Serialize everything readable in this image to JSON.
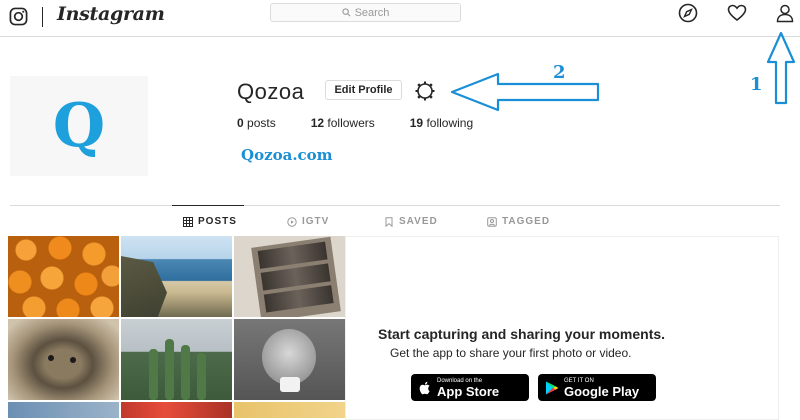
{
  "topbar": {
    "brand": "Instagram",
    "search_placeholder": "Search",
    "icons": [
      "instagram-glyph-icon",
      "search-icon",
      "compass-icon",
      "heart-icon",
      "profile-icon"
    ]
  },
  "profile": {
    "avatar_letter": "Q",
    "username": "Qozoa",
    "edit_button": "Edit Profile",
    "settings_icon": "gear-icon",
    "stats": {
      "posts_count": "0",
      "posts_label": " posts",
      "followers_count": "12",
      "followers_label": " followers",
      "following_count": "19",
      "following_label": " following"
    },
    "website": "Qozoa.com"
  },
  "annotations": {
    "label_1": "1",
    "label_2": "2",
    "color": "#1a8fd6"
  },
  "tabs": [
    {
      "label": "POSTS",
      "icon": "grid-icon",
      "active": true
    },
    {
      "label": "IGTV",
      "icon": "tv-icon",
      "active": false
    },
    {
      "label": "SAVED",
      "icon": "bookmark-icon",
      "active": false
    },
    {
      "label": "TAGGED",
      "icon": "tag-icon",
      "active": false
    }
  ],
  "grid_photos": [
    "oranges",
    "coastline",
    "photo-booth-strip",
    "dog",
    "cactus",
    "baby-with-camera",
    "blue",
    "red-flowers",
    "yellow"
  ],
  "get_app": {
    "title": "Start capturing and sharing your moments.",
    "subtitle": "Get the app to share your first photo or video.",
    "app_store_small": "Download on the",
    "app_store_big": "App Store",
    "google_play_small": "GET IT ON",
    "google_play_big": "Google Play"
  }
}
